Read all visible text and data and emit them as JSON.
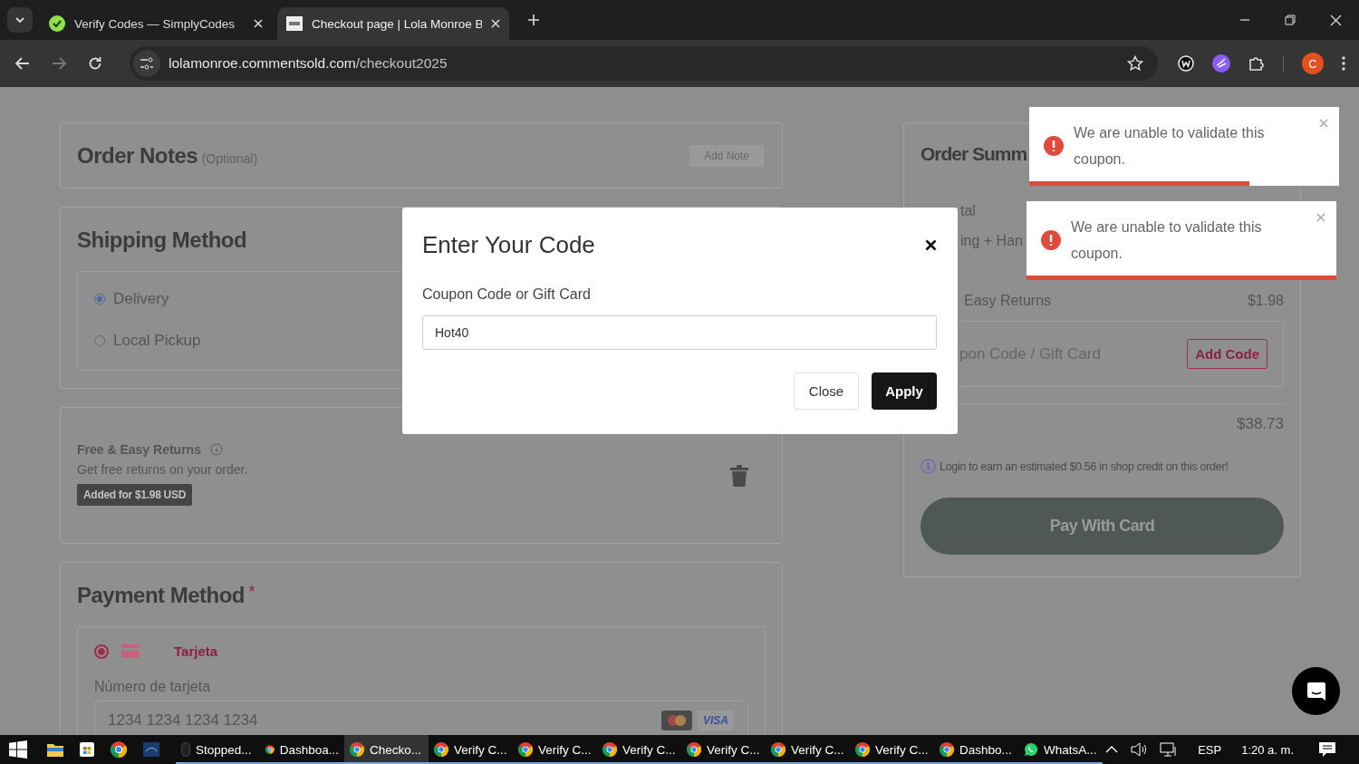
{
  "browser": {
    "tabs": [
      {
        "title": "Verify Codes — SimplyCodes",
        "selected": false
      },
      {
        "title": "Checkout page | Lola Monroe B",
        "selected": true
      }
    ],
    "url_host": "lolamonroe.commentsold.com",
    "url_path": "/checkout2025",
    "profile_initial": "C"
  },
  "order_notes": {
    "title": "Order Notes",
    "optional": "(Optional)",
    "button": "Add Note"
  },
  "shipping": {
    "title": "Shipping Method",
    "options": [
      {
        "label": "Delivery",
        "selected": true
      },
      {
        "label": "Local Pickup",
        "selected": false
      }
    ]
  },
  "returns": {
    "title": "Free & Easy Returns",
    "description": "Get free returns on your order.",
    "badge": "Added for $1.98 USD"
  },
  "payment": {
    "title": "Payment Method",
    "required_mark": "*",
    "methods": [
      {
        "label": "Tarjeta",
        "selected": true
      }
    ],
    "card_label": "Número de tarjeta",
    "card_placeholder": "1234 1234 1234 1234",
    "card_brand": "VISA"
  },
  "summary": {
    "title": "Order Summ",
    "rows": [
      {
        "label": "tal"
      },
      {
        "label": "ing + Han"
      },
      {
        "label": "Easy Returns",
        "value": "$1.98"
      }
    ],
    "coupon": {
      "label": "pon Code / Gift Card",
      "button": "Add Code"
    },
    "total": "$38.73",
    "credit_note": "Login to earn an estimated $0.56 in shop credit on this order!",
    "pay_button": "Pay With Card"
  },
  "modal": {
    "title": "Enter Your Code",
    "field_label": "Coupon Code or Gift Card",
    "value": "Hot40",
    "buttons": [
      {
        "label": "Close",
        "kind": "secondary"
      },
      {
        "label": "Apply",
        "kind": "primary"
      }
    ]
  },
  "toasts": [
    {
      "message": "We are unable to validate this coupon.",
      "level": 0.71
    },
    {
      "message": "We are unable to validate this coupon.",
      "level": 1
    }
  ],
  "taskbar": {
    "items": [
      {
        "label": "Stopped...",
        "kind": "media",
        "selected": false
      },
      {
        "label": "Dashboa...",
        "kind": "browser",
        "selected": false
      },
      {
        "label": "Checko...",
        "kind": "browser",
        "selected": true
      },
      {
        "label": "Verify C...",
        "kind": "browser",
        "selected": false
      },
      {
        "label": "Verify C...",
        "kind": "browser",
        "selected": false
      },
      {
        "label": "Verify C...",
        "kind": "browser",
        "selected": false
      },
      {
        "label": "Verify C...",
        "kind": "browser",
        "selected": false
      },
      {
        "label": "Verify C...",
        "kind": "browser",
        "selected": false
      },
      {
        "label": "Verify C...",
        "kind": "browser",
        "selected": false
      },
      {
        "label": "Dashbo...",
        "kind": "browser",
        "selected": false
      },
      {
        "label": "WhatsA...",
        "kind": "messenger",
        "selected": false
      }
    ],
    "language": "ESP",
    "time": "1:20 a. m."
  }
}
